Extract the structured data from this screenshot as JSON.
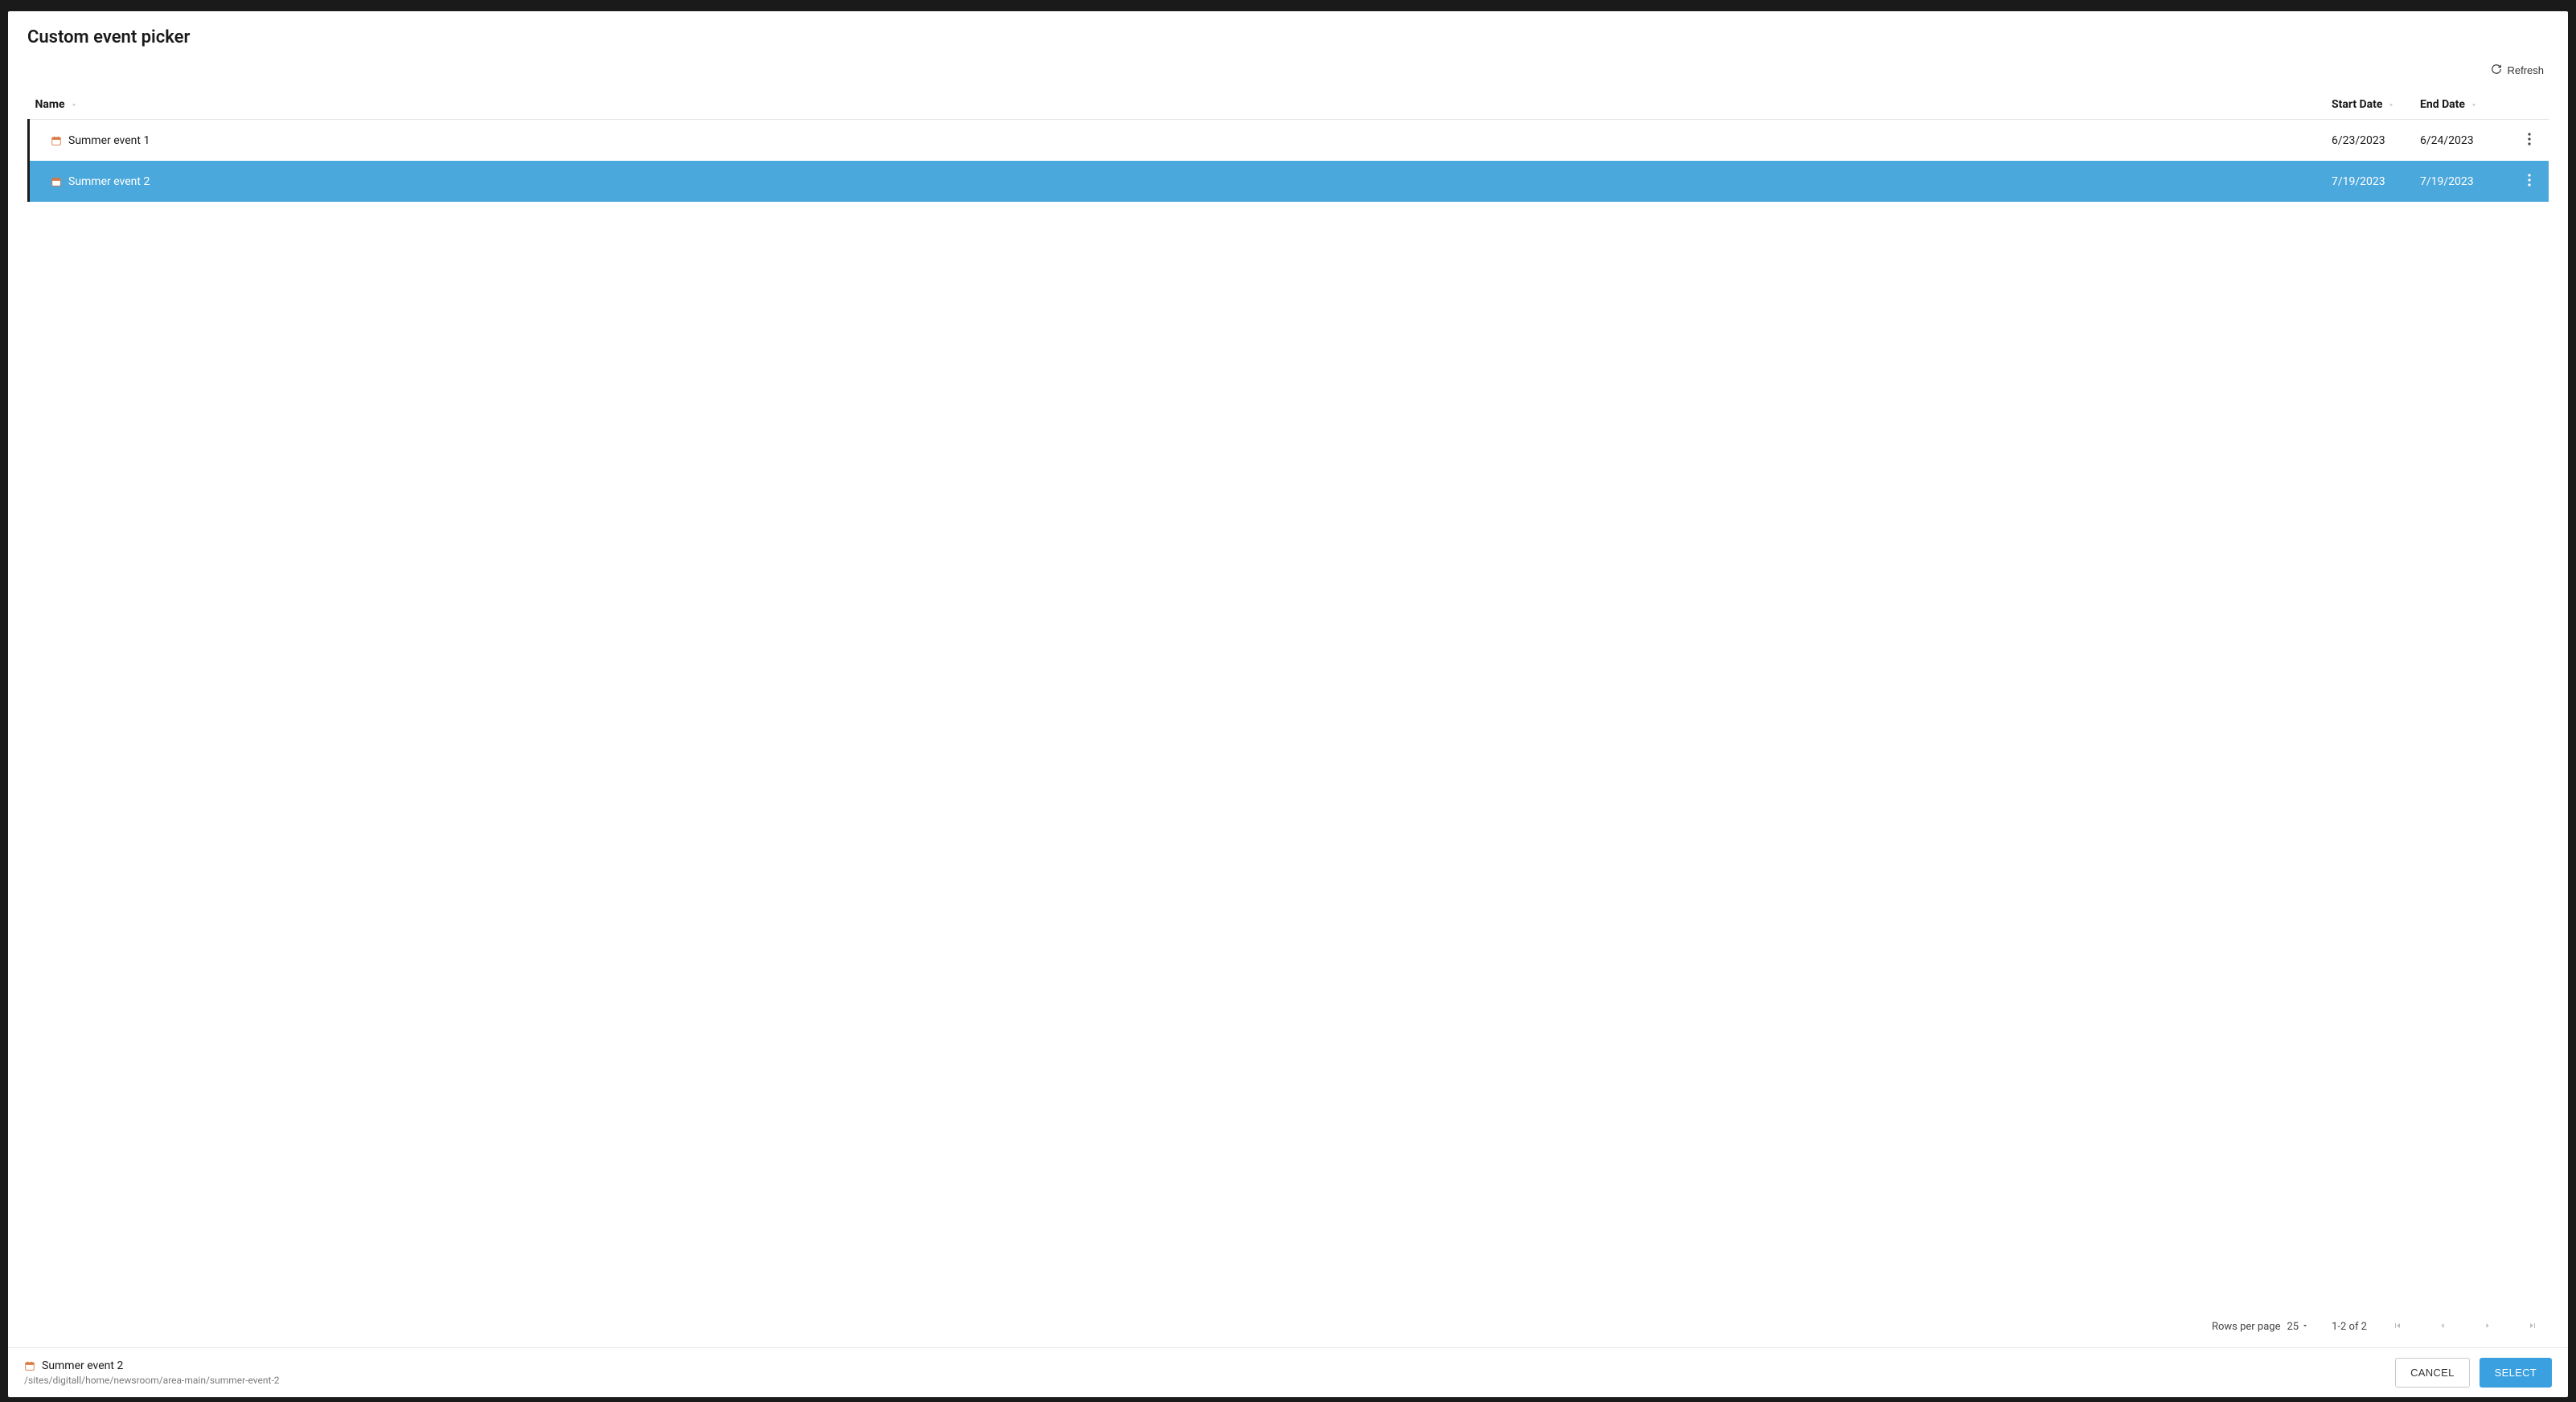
{
  "modal": {
    "title": "Custom event picker",
    "refresh_label": "Refresh"
  },
  "table": {
    "columns": {
      "name": "Name",
      "start_date": "Start Date",
      "end_date": "End Date"
    },
    "rows": [
      {
        "name": "Summer event 1",
        "start_date": "6/23/2023",
        "end_date": "6/24/2023",
        "selected": false
      },
      {
        "name": "Summer event 2",
        "start_date": "7/19/2023",
        "end_date": "7/19/2023",
        "selected": true
      }
    ]
  },
  "pagination": {
    "rows_per_page_label": "Rows per page",
    "rows_per_page_value": "25",
    "range_label": "1-2 of 2"
  },
  "selection": {
    "name": "Summer event 2",
    "path": "/sites/digitall/home/newsroom/area-main/summer-event-2"
  },
  "footer": {
    "cancel_label": "CANCEL",
    "select_label": "SELECT"
  }
}
